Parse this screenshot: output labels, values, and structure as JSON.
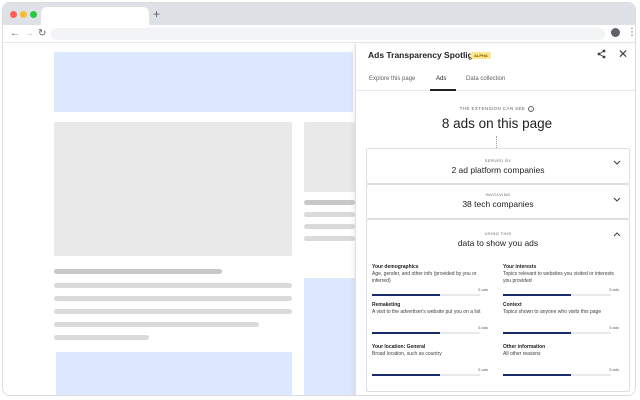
{
  "browser": {
    "new_tab_symbol": "+",
    "traffic_colors": [
      "#ff5f57",
      "#febc2e",
      "#28c840"
    ],
    "back_icon": "←",
    "forward_icon": "→",
    "reload_icon": "↻",
    "menu_icon": "⋮"
  },
  "panel": {
    "title": "Ads Transparency Spotlight",
    "badge": "ALPHA",
    "share_icon": "share-icon",
    "close_icon": "✕",
    "tabs": [
      {
        "label": "Explore this page",
        "active": false
      },
      {
        "label": "Ads",
        "active": true
      },
      {
        "label": "Data collection",
        "active": false
      }
    ],
    "can_see_label": "THE EXTENSION CAN SEE",
    "info_glyph": "i",
    "ads_count_text": "8 ads on this page",
    "served_by": {
      "caption": "SERVED BY",
      "text": "2 ad platform companies",
      "chevron": "⌄"
    },
    "involving": {
      "caption": "INVOLVING",
      "text": "38 tech companies",
      "chevron": "⌄"
    },
    "using": {
      "caption": "USING THIS",
      "text": "data to show you ads",
      "chevron": "⌃"
    },
    "data_types": [
      {
        "title": "Your demographics",
        "desc": "Age, gender, and other info (provided by you or inferred)",
        "count": "5 ads",
        "fraction": 0.63
      },
      {
        "title": "Your interests",
        "desc": "Topics relevant to websites you visited or interests you provided",
        "count": "5 ads",
        "fraction": 0.63
      },
      {
        "title": "Remaketing",
        "desc": "A visit to the advertiser's website put you on a list",
        "count": "5 ads",
        "fraction": 0.63
      },
      {
        "title": "Context",
        "desc": "Topics shown to anyone who visits this page",
        "count": "5 ads",
        "fraction": 0.63
      },
      {
        "title": "Your location: General",
        "desc": "Broad location, such as country",
        "count": "5 ads",
        "fraction": 0.63
      },
      {
        "title": "Other information",
        "desc": "All other reasons",
        "count": "5 ads",
        "fraction": 0.63
      }
    ]
  },
  "colors": {
    "accent_bar": "#1a2b6b",
    "placeholder_blue": "#dce8fd",
    "badge_yellow": "#fde68a"
  }
}
